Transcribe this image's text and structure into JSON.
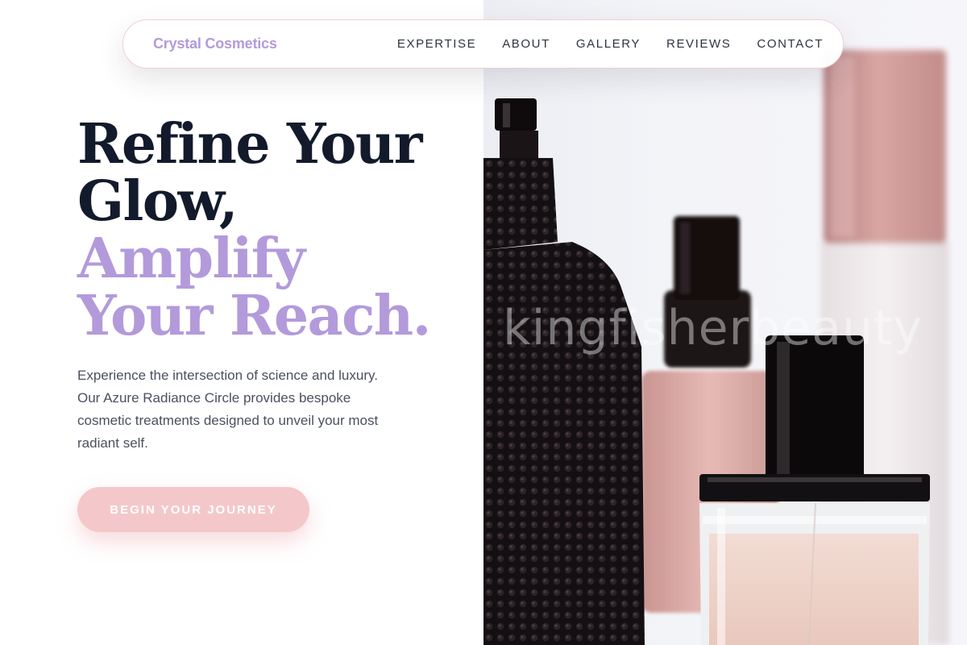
{
  "brand": {
    "name": "Crystal Cosmetics"
  },
  "nav": {
    "items": [
      {
        "label": "EXPERTISE"
      },
      {
        "label": "ABOUT"
      },
      {
        "label": "GALLERY"
      },
      {
        "label": "REVIEWS"
      },
      {
        "label": "CONTACT"
      }
    ]
  },
  "hero": {
    "headline_line1": "Refine Your",
    "headline_line2": "Glow,",
    "headline_line3": "Amplify",
    "headline_line4": "Your Reach.",
    "lede": "Experience the intersection of science and luxury. Our Azure Radiance Circle provides bespoke cosmetic treatments designed to unveil your most radiant self.",
    "cta_label": "BEGIN YOUR JOURNEY"
  },
  "photo": {
    "watermark": "kingfisherbeauty"
  },
  "colors": {
    "accent_lavender": "#b39adb",
    "headline_dark": "#121a2c",
    "cta_pink": "#f4c8ca",
    "nav_border": "#f2cfd3"
  }
}
